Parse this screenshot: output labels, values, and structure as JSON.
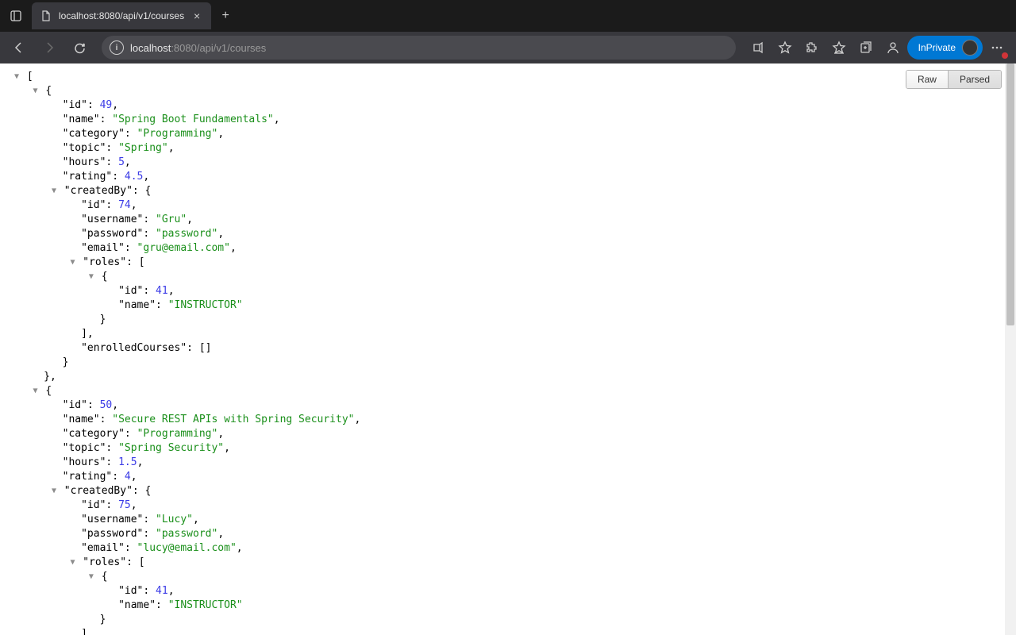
{
  "tab": {
    "title": "localhost:8080/api/v1/courses"
  },
  "url": {
    "host": "localhost",
    "rest": ":8080/api/v1/courses"
  },
  "inprivate": "InPrivate",
  "view": {
    "raw": "Raw",
    "parsed": "Parsed"
  },
  "json": [
    {
      "id": 49,
      "name": "Spring Boot Fundamentals",
      "category": "Programming",
      "topic": "Spring",
      "hours": 5,
      "rating": 4.5,
      "createdBy": {
        "id": 74,
        "username": "Gru",
        "password": "password",
        "email": "gru@email.com",
        "roles": [
          {
            "id": 41,
            "name": "INSTRUCTOR"
          }
        ],
        "enrolledCourses": []
      }
    },
    {
      "id": 50,
      "name": "Secure REST APIs with Spring Security",
      "category": "Programming",
      "topic": "Spring Security",
      "hours": 1.5,
      "rating": 4,
      "createdBy": {
        "id": 75,
        "username": "Lucy",
        "password": "password",
        "email": "lucy@email.com",
        "roles": [
          {
            "id": 41,
            "name": "INSTRUCTOR"
          }
        ]
      }
    }
  ]
}
